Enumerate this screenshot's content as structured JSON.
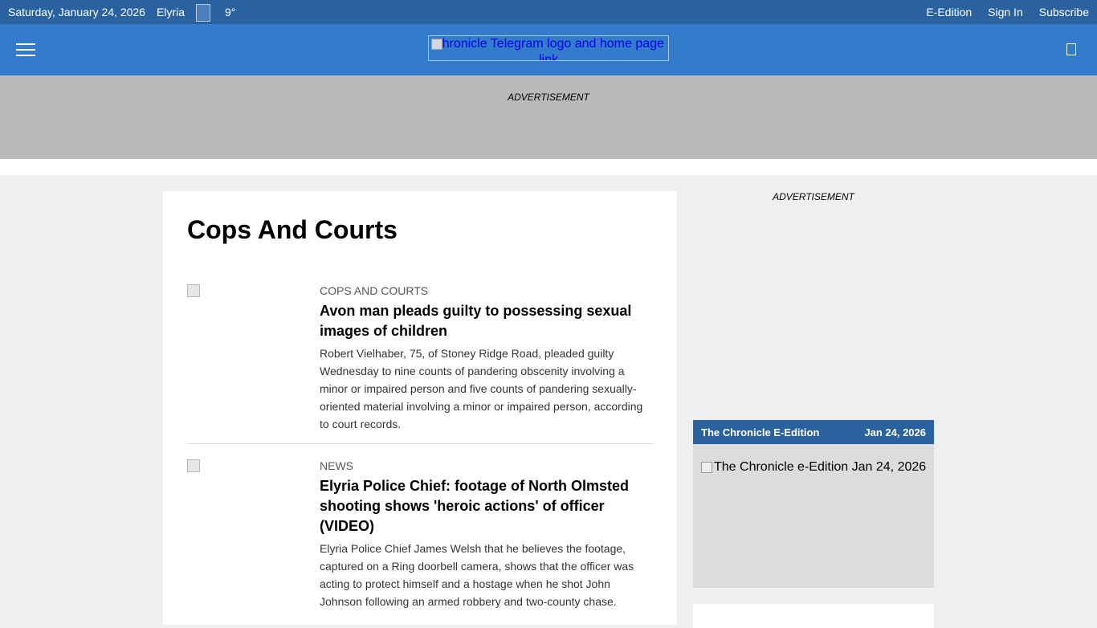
{
  "topbar": {
    "date": "Saturday, January 24, 2026",
    "city": "Elyria",
    "weather_icon": "weather-icon",
    "temperature": "9°",
    "links": [
      "E-Edition",
      "Sign In",
      "Subscribe"
    ]
  },
  "header": {
    "menu_icon": "hamburger-menu-icon",
    "logo_alt": "Chronicle Telegram logo and home page link",
    "search_icon": "search-icon"
  },
  "ads": {
    "top_label": "ADVERTISEMENT",
    "side_label": "ADVERTISEMENT"
  },
  "main": {
    "title": "Cops And Courts",
    "articles": [
      {
        "kicker": "COPS AND COURTS",
        "headline": "Avon man pleads guilty to possessing sexual images of children",
        "summary": "Robert Vielhaber, 75, of Stoney Ridge Road, pleaded guilty Wednesday to nine counts of pandering obscenity involving a minor or impaired person and five counts of pandering sexually-oriented material involving a minor or impaired person, according to court records."
      },
      {
        "kicker": "NEWS",
        "headline": "Elyria Police Chief: footage of North Olmsted shooting shows 'heroic actions' of officer (VIDEO)",
        "summary": "Elyria Police Chief James Welsh that he believes the footage, captured on a Ring doorbell camera, shows that the officer was acting to protect himself and a hostage when he shot John Johnson following an armed robbery and two-county chase."
      }
    ]
  },
  "eedition": {
    "title": "The Chronicle E-Edition",
    "date": "Jan 24, 2026",
    "cover_alt": "The Chronicle e-Edition Jan 24, 2026"
  },
  "colors": {
    "topbar": "#2a62a0",
    "header": "#337ccc",
    "ad_band": "#bababa",
    "page_bg": "#efefef"
  }
}
